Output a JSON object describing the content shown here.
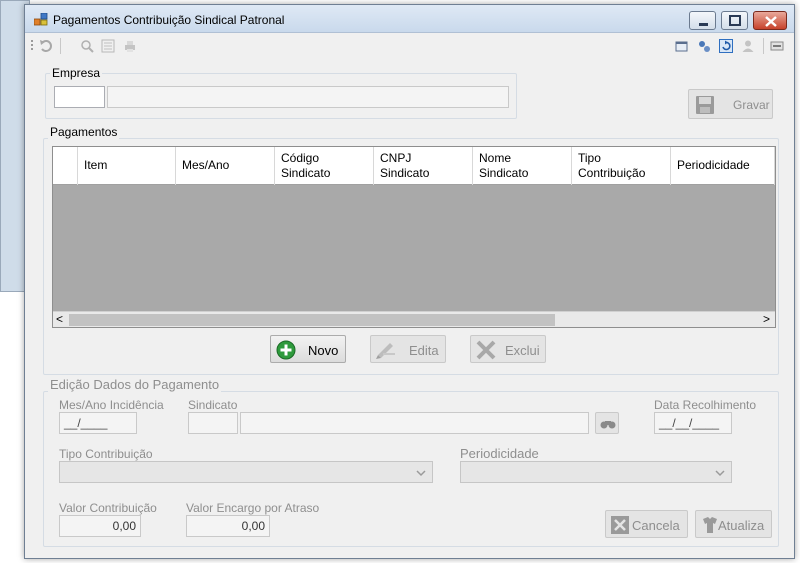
{
  "window": {
    "title": "Pagamentos Contribuição Sindical Patronal"
  },
  "empresa": {
    "label": "Empresa",
    "code_value": "",
    "name_value": ""
  },
  "toolbar": {
    "save_label": "Gravar"
  },
  "pagamentos": {
    "label": "Pagamentos",
    "columns": [
      {
        "line1": "Item",
        "line2": ""
      },
      {
        "line1": "Mes/Ano",
        "line2": ""
      },
      {
        "line1": "Código",
        "line2": "Sindicato"
      },
      {
        "line1": "CNPJ",
        "line2": "Sindicato"
      },
      {
        "line1": "Nome",
        "line2": "Sindicato"
      },
      {
        "line1": "Tipo",
        "line2": "Contribuição"
      },
      {
        "line1": "Periodicidade",
        "line2": ""
      }
    ],
    "scroll_left": "<",
    "scroll_right": ">"
  },
  "actions": {
    "novo": "Novo",
    "edita": "Edita",
    "exclui": "Exclui"
  },
  "edicao": {
    "label": "Edição Dados do Pagamento",
    "mes_ano_label": "Mes/Ano Incidência",
    "mes_ano_value": "__/____",
    "sindicato_label": "Sindicato",
    "sindicato_code": "",
    "sindicato_name": "",
    "data_label": "Data Recolhimento",
    "data_value": "__/__/____",
    "tipo_label": "Tipo Contribuição",
    "tipo_value": "",
    "periodicidade_label": "Periodicidade",
    "periodicidade_value": "",
    "valor_contrib_label": "Valor Contribuição",
    "valor_contrib_value": "0,00",
    "valor_encargo_label": "Valor Encargo por Atraso",
    "valor_encargo_value": "0,00",
    "cancela": "Cancela",
    "atualiza": "Atualiza"
  },
  "colors": {
    "grid_body": "#a9a9a9",
    "add_icon_green": "#2e9a3c"
  }
}
